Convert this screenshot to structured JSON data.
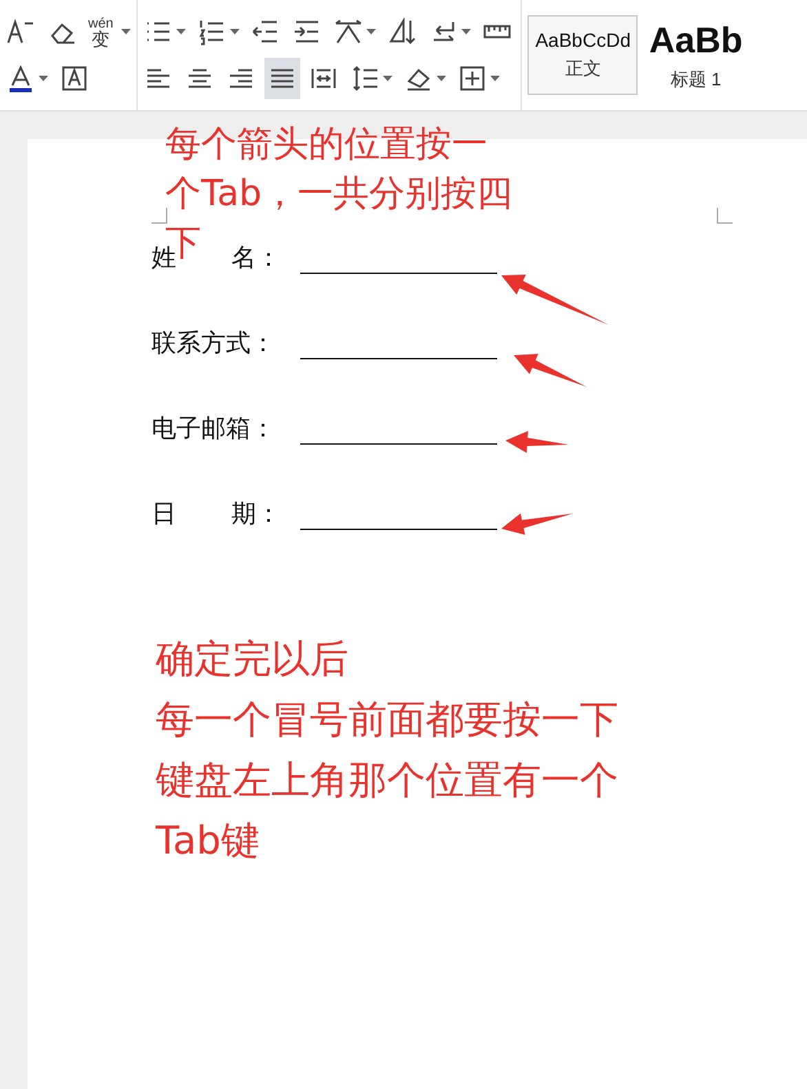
{
  "ribbon": {
    "font_group": {
      "phonetic": {
        "top": "wén",
        "bottom": "变"
      }
    },
    "paragraph_group": {
      "align_buttons": [
        {
          "kind": "left",
          "selected": false
        },
        {
          "kind": "center",
          "selected": false
        },
        {
          "kind": "right",
          "selected": false
        },
        {
          "kind": "justify",
          "selected": true
        },
        {
          "kind": "distribute",
          "selected": false
        }
      ]
    },
    "styles": [
      {
        "sample": "AaBbCcDd",
        "name": "正文",
        "selected": true
      },
      {
        "sample": "AaBb",
        "name": "标题 1",
        "selected": false
      }
    ]
  },
  "document": {
    "fields": [
      {
        "label": [
          "姓",
          "名："
        ]
      },
      {
        "label": [
          "联系方式："
        ]
      },
      {
        "label": [
          "电子邮箱："
        ]
      },
      {
        "label": [
          "日",
          "期："
        ]
      }
    ]
  },
  "annotations": [
    {
      "lines": [
        "每个箭头的位置按一",
        "个Tab，一共分别按四",
        "下"
      ]
    },
    {
      "lines": [
        "确定完以后",
        "每一个冒号前面都要按一下",
        "键盘左上角那个位置有一个",
        "Tab键"
      ]
    }
  ]
}
